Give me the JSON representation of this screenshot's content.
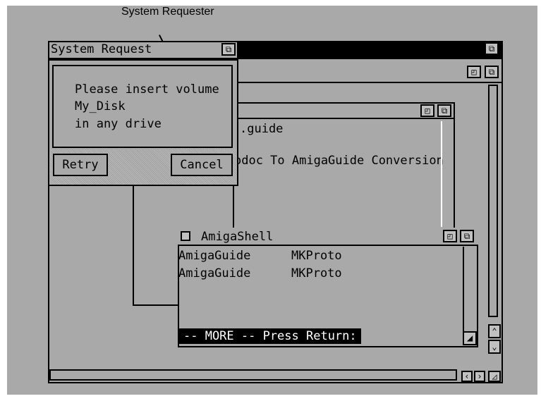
{
  "annotation": {
    "label": "System Requester"
  },
  "system_request": {
    "title": "System Request",
    "message": [
      "Please insert volume",
      "My_Disk",
      "in any drive"
    ],
    "buttons": {
      "retry": "Retry",
      "cancel": "Cancel"
    }
  },
  "guide_window": {
    "filename": ".guide",
    "heading": "odoc To AmigaGuide Conversion"
  },
  "shell": {
    "title": "AmigaShell",
    "lines": [
      {
        "left": "AmigaGuide",
        "right": "MKProto"
      },
      {
        "left": "AmigaGuide",
        "right": "MKProto"
      }
    ],
    "prompt": "-- MORE -- Press Return:"
  },
  "icons": {
    "depth": "depth-gadget-icon",
    "zoom": "zoom-gadget-icon",
    "close": "close-gadget-icon",
    "size": "size-gadget-icon",
    "arrows": [
      "arrow-up-icon",
      "arrow-down-icon",
      "arrow-left-icon",
      "arrow-right-icon"
    ]
  }
}
